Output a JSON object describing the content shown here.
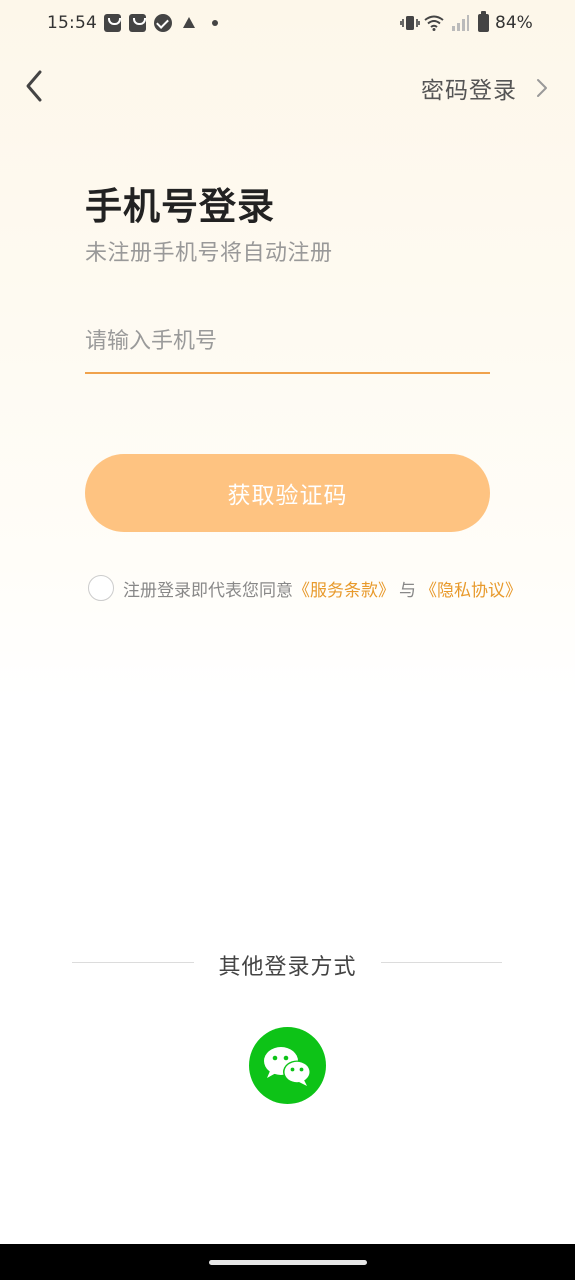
{
  "status_bar": {
    "time": "15:54",
    "battery": "84%",
    "icons": [
      "shopping-bag-icon",
      "shopping-bag-icon",
      "check-circle-icon",
      "warning-icon",
      "dot-icon",
      "vibrate-icon",
      "wifi-icon",
      "signal-icon",
      "battery-icon"
    ]
  },
  "header": {
    "back_icon": "chevron-left-icon",
    "password_login": "密码登录",
    "password_login_icon": "chevron-right-icon"
  },
  "main": {
    "title": "手机号登录",
    "subtitle": "未注册手机号将自动注册",
    "phone_placeholder": "请输入手机号",
    "phone_value": "",
    "get_code_button": "获取验证码"
  },
  "agreement": {
    "prefix": "注册登录即代表您同意",
    "terms_link": "《服务条款》",
    "conjunction": "与",
    "privacy_link": "《隐私协议》"
  },
  "other_login": {
    "label": "其他登录方式",
    "wechat_icon": "wechat-icon"
  },
  "colors": {
    "accent": "#f0a24c",
    "button_bg": "#fec381",
    "link": "#e89a2c",
    "wechat_green": "#0dc317"
  }
}
